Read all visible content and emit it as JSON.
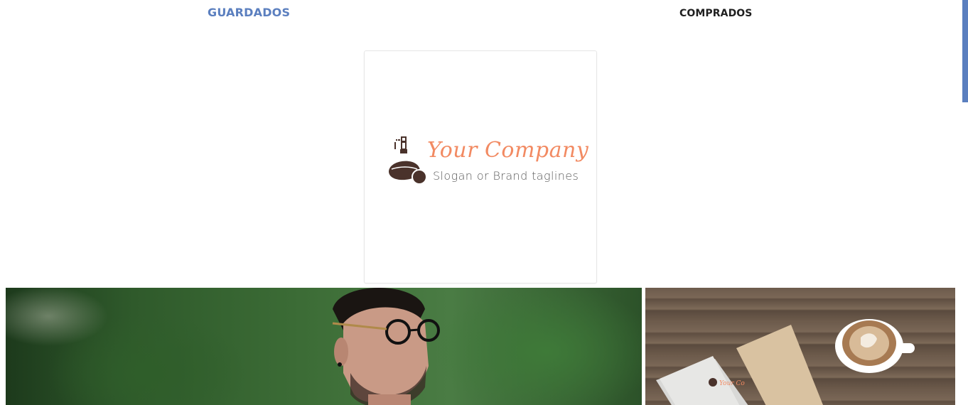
{
  "tabs": {
    "saved_label": "GUARDADOS",
    "bought_label": "COMPRADOS"
  },
  "logo_card": {
    "company": "Your Company",
    "slogan": "Slogan or Brand taglines",
    "icon": "perfume-bottle-icon"
  },
  "photos": [
    {
      "subject": "man-with-glasses-ferns"
    },
    {
      "subject": "desk-coffee-branding-mockup"
    }
  ],
  "colors": {
    "accent": "#5b7fbf",
    "brand_orange": "#f28a62",
    "brand_brown": "#4a322b"
  }
}
